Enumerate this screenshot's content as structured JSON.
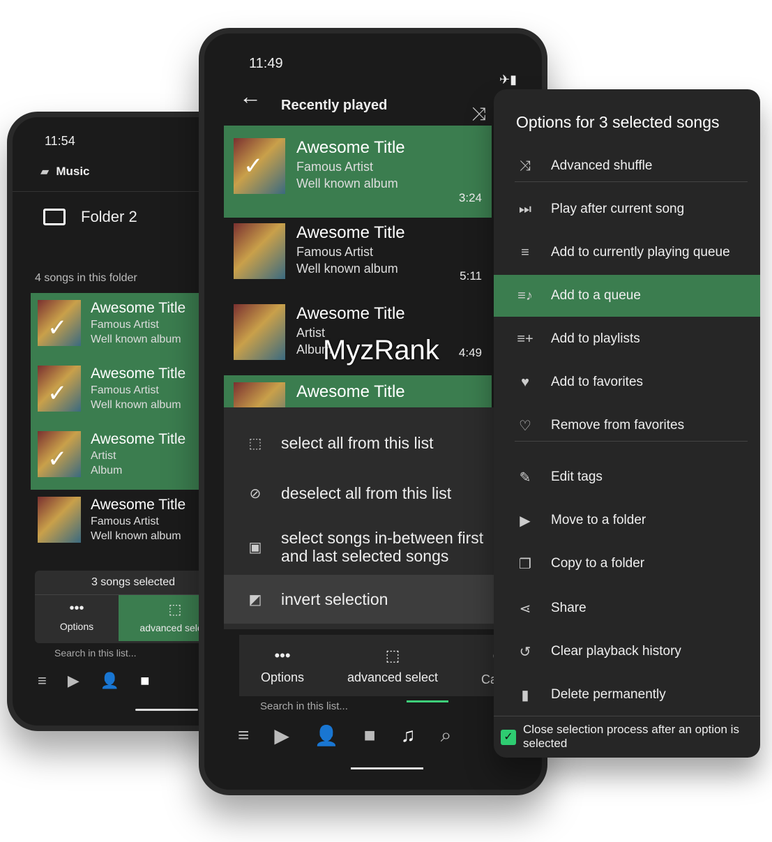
{
  "left": {
    "time": "11:54",
    "header": "Music",
    "folder": "Folder 2",
    "count": "4 songs in this folder",
    "songs": [
      {
        "title": "Awesome Title",
        "artist": "Famous Artist",
        "album": "Well known album",
        "selected": true
      },
      {
        "title": "Awesome Title",
        "artist": "Famous Artist",
        "album": "Well known album",
        "selected": true
      },
      {
        "title": "Awesome Title",
        "artist": "Artist",
        "album": "Album",
        "selected": true
      },
      {
        "title": "Awesome Title",
        "artist": "Famous Artist",
        "album": "Well known album",
        "selected": false
      }
    ],
    "selected_label": "3 songs selected",
    "options": "Options",
    "advanced": "advanced select",
    "search": "Search in this list..."
  },
  "middle": {
    "time": "11:49",
    "title": "Recently played",
    "songs": [
      {
        "title": "Awesome Title",
        "artist": "Famous Artist",
        "album": "Well known album",
        "duration": "3:24",
        "selected": true
      },
      {
        "title": "Awesome Title",
        "artist": "Famous Artist",
        "album": "Well known album",
        "duration": "5:11",
        "selected": false
      },
      {
        "title": "Awesome Title",
        "artist": "Artist",
        "album": "Album",
        "duration": "4:49",
        "selected": false
      },
      {
        "title": "Awesome Title",
        "selected": true
      }
    ],
    "menu": [
      "select all from this list",
      "deselect all from this list",
      "select songs in-between first and last selected songs",
      "invert selection"
    ],
    "options": "Options",
    "advanced": "advanced select",
    "cancel": "Cancel",
    "search": "Search in this list...",
    "watermark": "MyzRank"
  },
  "right": {
    "title": "Options for 3 selected songs",
    "items": [
      {
        "label": "Advanced shuffle",
        "icon": "shuffle-icon"
      },
      {
        "label": "Play after current song",
        "icon": "play-next-icon"
      },
      {
        "label": "Add to currently playing queue",
        "icon": "queue-add-icon"
      },
      {
        "label": "Add to a queue",
        "icon": "queue-music-icon",
        "highlighted": true
      },
      {
        "label": "Add to playlists",
        "icon": "playlist-add-icon"
      },
      {
        "label": "Add to favorites",
        "icon": "heart-icon"
      },
      {
        "label": "Remove from favorites",
        "icon": "heart-outline-icon"
      },
      {
        "label": "Edit tags",
        "icon": "pencil-icon"
      },
      {
        "label": "Move to a folder",
        "icon": "folder-move-icon"
      },
      {
        "label": "Copy to a folder",
        "icon": "folder-copy-icon"
      },
      {
        "label": "Share",
        "icon": "share-icon"
      },
      {
        "label": "Clear playback history",
        "icon": "history-icon"
      },
      {
        "label": "Delete permanently",
        "icon": "trash-icon"
      }
    ],
    "checkbox": "Close selection process after an option is selected",
    "checked": true
  },
  "colors": {
    "accent": "#3b7d4f",
    "check": "#2ecc71",
    "bg": "#1b1b1b"
  }
}
